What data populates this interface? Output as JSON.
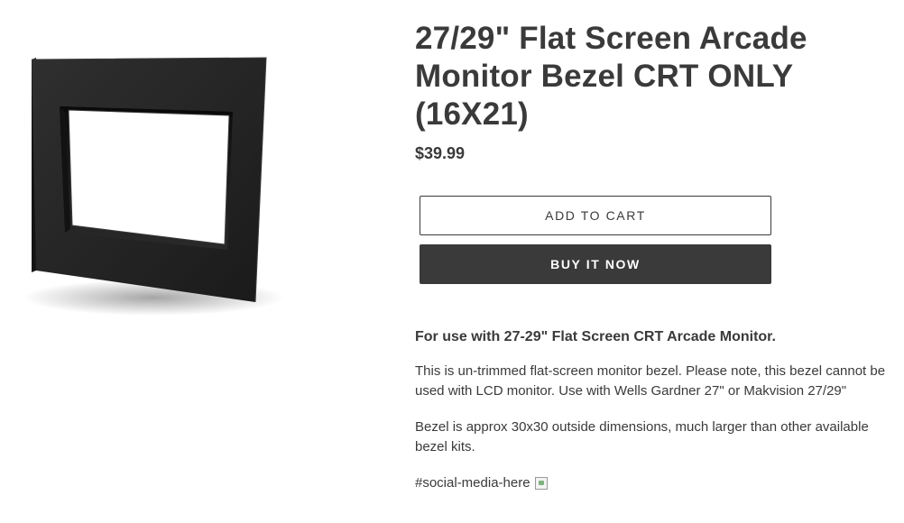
{
  "product": {
    "title": "27/29\" Flat Screen Arcade Monitor Bezel CRT ONLY (16X21)",
    "price": "$39.99",
    "image_icon": "monitor-bezel-product-image"
  },
  "actions": {
    "add_to_cart": "ADD TO CART",
    "buy_it_now": "BUY IT NOW"
  },
  "description": {
    "lead": "For use with 27-29\" Flat Screen CRT Arcade Monitor.",
    "paragraphs": [
      "This is un-trimmed flat-screen monitor bezel. Please note, this bezel cannot be used with LCD monitor. Use with Wells Gardner 27\" or Makvision 27/29\"",
      "Bezel is approx 30x30 outside dimensions, much larger than other available bezel kits."
    ],
    "social_tag": "#social-media-here",
    "social_image_icon": "broken-image-icon"
  },
  "colors": {
    "text": "#3a3a3a",
    "button_dark": "#3a3a3a",
    "background": "#ffffff"
  }
}
